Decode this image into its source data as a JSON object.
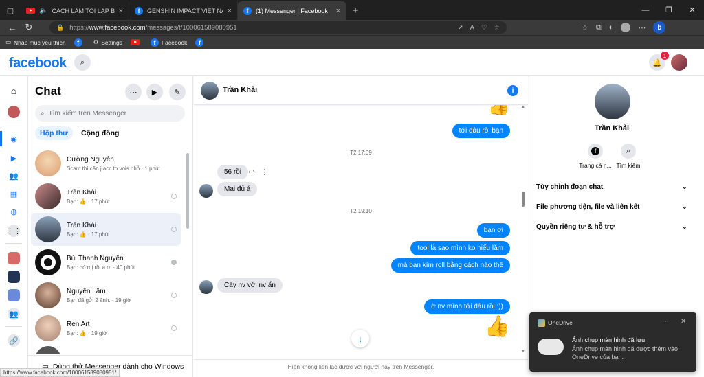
{
  "browser": {
    "tabs": [
      {
        "title": "CÁCH LÀM TÔI LẠP BÁT - N",
        "icon": "youtube-icon"
      },
      {
        "title": "GENSHIN IMPACT VIỆT NAM TRẢ",
        "icon": "facebook-icon"
      },
      {
        "title": "(1) Messenger | Facebook",
        "icon": "facebook-icon"
      }
    ],
    "new_tab": "+",
    "url_prefix": "https://",
    "url_host": "www.facebook.com",
    "url_path": "/messages/t/100061589080951",
    "favorites": [
      {
        "label": "Nhập mục yêu thích"
      },
      {
        "label": ""
      },
      {
        "label": "Settings"
      },
      {
        "label": ""
      },
      {
        "label": "Facebook"
      },
      {
        "label": ""
      }
    ],
    "status_url": "https://www.facebook.com/100061589080951/"
  },
  "facebook": {
    "logo": "facebook",
    "notification_count": "1"
  },
  "chat": {
    "title": "Chat",
    "search_placeholder": "Tìm kiếm trên Messenger",
    "tabs": [
      "Hộp thư",
      "Cộng đồng"
    ],
    "conversations": [
      {
        "name": "Cường Nguyễn",
        "preview": "Scam thì cần j acc to vois nhỏ · 1 phút"
      },
      {
        "name": "Trần Khải",
        "preview": "Bạn: 👍 · 17 phút"
      },
      {
        "name": "Trần Khải",
        "preview": "Bạn: 👍 · 17 phút"
      },
      {
        "name": "Bùi Thanh Nguyên",
        "preview": "Bạn: bó mị rồi a ơi · 40 phút"
      },
      {
        "name": "Nguyễn Lâm",
        "preview": "Bạn đã gửi 2 ảnh. · 19 giờ"
      },
      {
        "name": "Ren Art",
        "preview": "Bạn: 👍 · 19 giờ"
      }
    ],
    "try_windows": "Dùng thử Messenger dành cho Windows"
  },
  "conversation": {
    "name": "Trần Khải",
    "messages": [
      {
        "text": "tới đâu rồi bạn"
      },
      {
        "text": "T2 17:09"
      },
      {
        "text": "56 rồi"
      },
      {
        "text": "Mai đủ á"
      },
      {
        "text": "T2 19:10"
      },
      {
        "text": "bạn ơi"
      },
      {
        "text": "tool là sao mình ko hiểu lắm"
      },
      {
        "text": "mà bạn kím roll bằng cách nào thế"
      },
      {
        "text": "Cày nv với nv ẩn"
      },
      {
        "text": "ờ nv mình tới đâu rồi :))"
      }
    ],
    "footer": "Hiện không liên lạc được với người này trên Messenger."
  },
  "info": {
    "name": "Trần Khải",
    "actions": [
      "Trang cá n...",
      "Tìm kiếm"
    ],
    "sections": [
      "Tùy chỉnh đoạn chat",
      "File phương tiện, file và liên kết",
      "Quyền riêng tư & hỗ trợ"
    ]
  },
  "toast": {
    "app": "OneDrive",
    "title": "Ảnh chụp màn hình đã lưu",
    "body": "Ảnh chụp màn hình đã được thêm vào OneDrive của bạn."
  }
}
